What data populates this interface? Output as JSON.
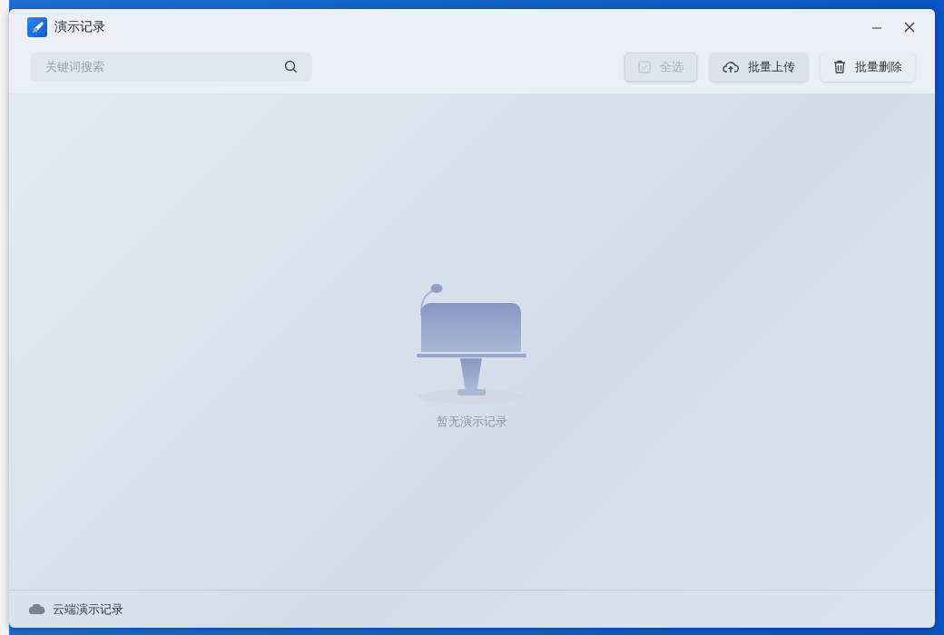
{
  "window": {
    "title": "演示记录"
  },
  "search": {
    "placeholder": "关键词搜索"
  },
  "toolbar_buttons": [
    {
      "kind": "select-all",
      "label": "全选",
      "disabled": true
    },
    {
      "kind": "upload",
      "label": "批量上传",
      "disabled": false
    },
    {
      "kind": "delete",
      "label": "批量删除",
      "disabled": false
    }
  ],
  "empty_state": {
    "message": "暂无演示记录"
  },
  "footer": {
    "link": "云端演示记录"
  }
}
